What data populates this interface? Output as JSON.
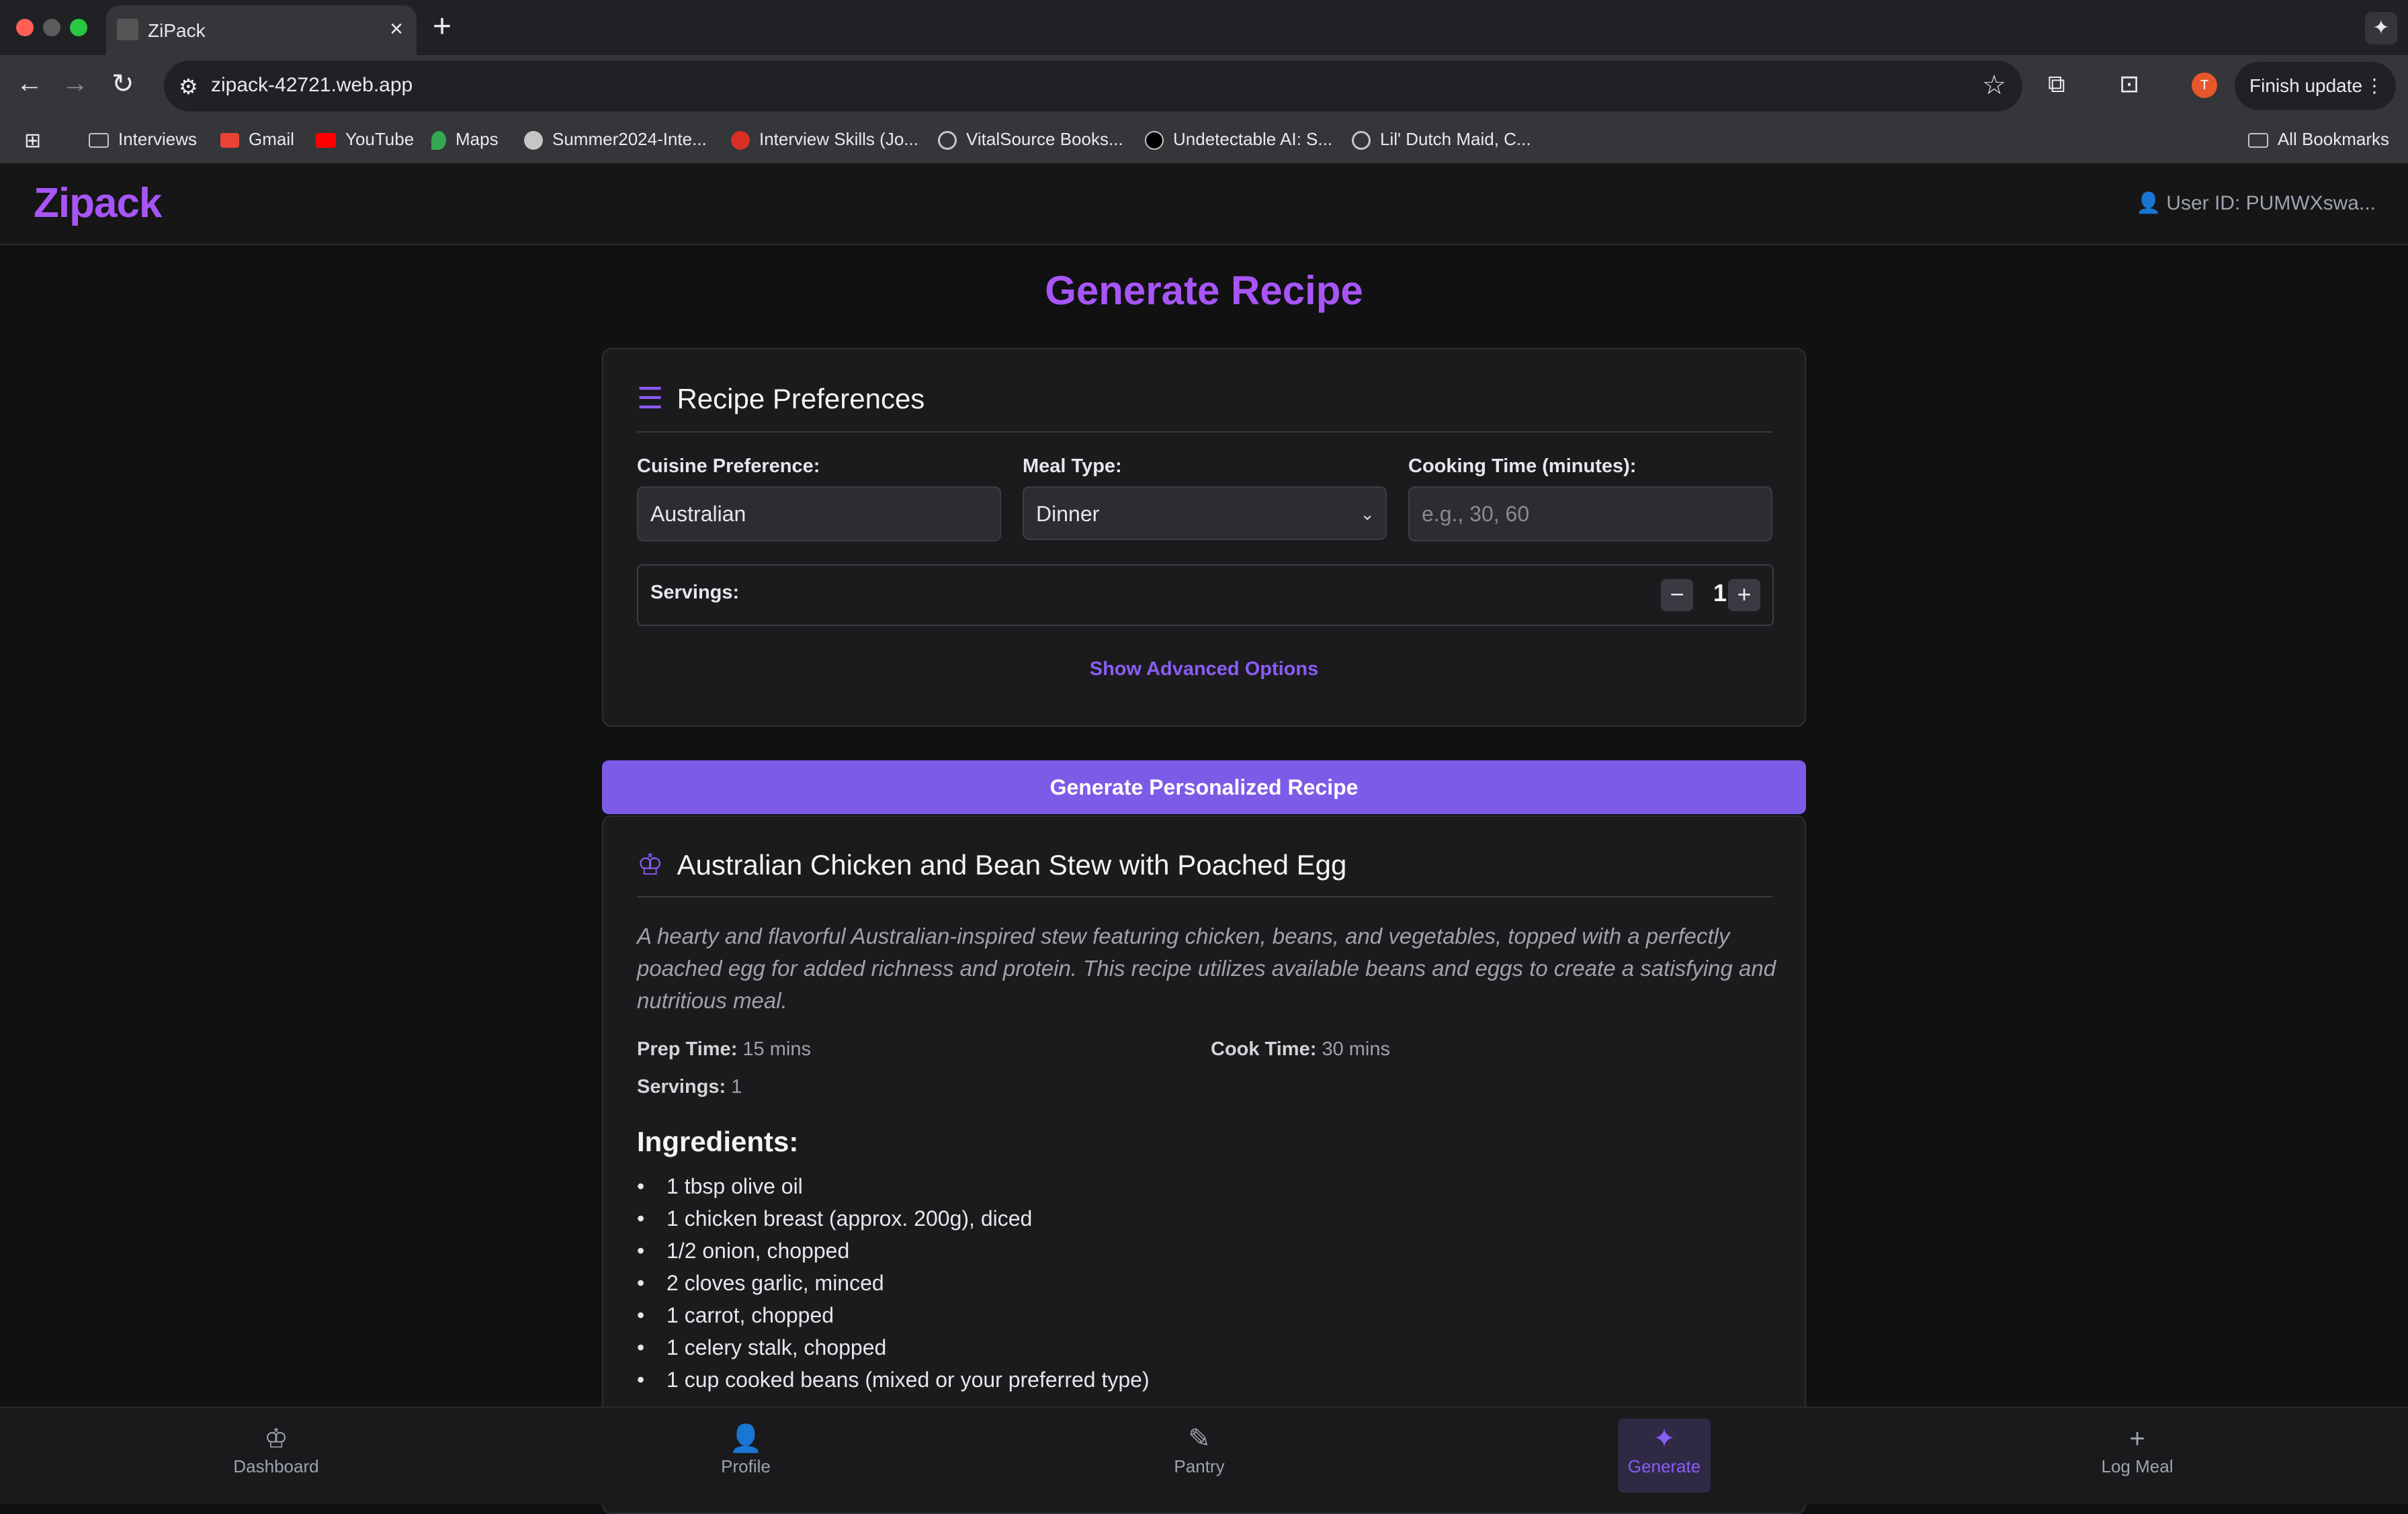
{
  "browser": {
    "tab_title": "ZiPack",
    "url": "zipack-42721.web.app",
    "profile_initial": "T",
    "finish_update": "Finish update",
    "bookmarks": [
      "Interviews",
      "Gmail",
      "YouTube",
      "Maps",
      "Summer2024-Inte...",
      "Interview Skills (Jo...",
      "VitalSource Books...",
      "Undetectable AI: S...",
      "Lil' Dutch Maid, C..."
    ],
    "all_bookmarks": "All Bookmarks"
  },
  "header": {
    "brand": "Zipack",
    "user_id": "User ID: PUMWXswa..."
  },
  "page_title": "Generate Recipe",
  "preferences": {
    "title": "Recipe Preferences",
    "cuisine_label": "Cuisine Preference:",
    "cuisine_value": "Australian",
    "meal_type_label": "Meal Type:",
    "meal_type_value": "Dinner",
    "cooking_time_label": "Cooking Time (minutes):",
    "cooking_time_placeholder": "e.g., 30, 60",
    "servings_label": "Servings:",
    "servings_value": "1",
    "minus": "−",
    "plus": "+",
    "show_advanced": "Show Advanced Options"
  },
  "generate_button": "Generate Personalized Recipe",
  "recipe": {
    "title": "Australian Chicken and Bean Stew with Poached Egg",
    "description": "A hearty and flavorful Australian-inspired stew featuring chicken, beans, and vegetables, topped with a perfectly poached egg for added richness and protein. This recipe utilizes available beans and eggs to create a satisfying and nutritious meal.",
    "prep_label": "Prep Time:",
    "prep_value": "15 mins",
    "cook_label": "Cook Time:",
    "cook_value": "30 mins",
    "servings_label": "Servings:",
    "servings_value": "1",
    "ingredients_heading": "Ingredients:",
    "ingredients": [
      "1 tbsp olive oil",
      "1 chicken breast (approx. 200g), diced",
      "1/2 onion, chopped",
      "2 cloves garlic, minced",
      "1 carrot, chopped",
      "1 celery stalk, chopped",
      "1 cup cooked beans (mixed or your preferred type)"
    ]
  },
  "bottom_nav": {
    "dashboard": "Dashboard",
    "profile": "Profile",
    "pantry": "Pantry",
    "generate": "Generate",
    "log_meal": "Log Meal"
  },
  "colors": {
    "accent": "#8b5cf6",
    "brand": "#a855f7",
    "button": "#7c5ce6"
  }
}
